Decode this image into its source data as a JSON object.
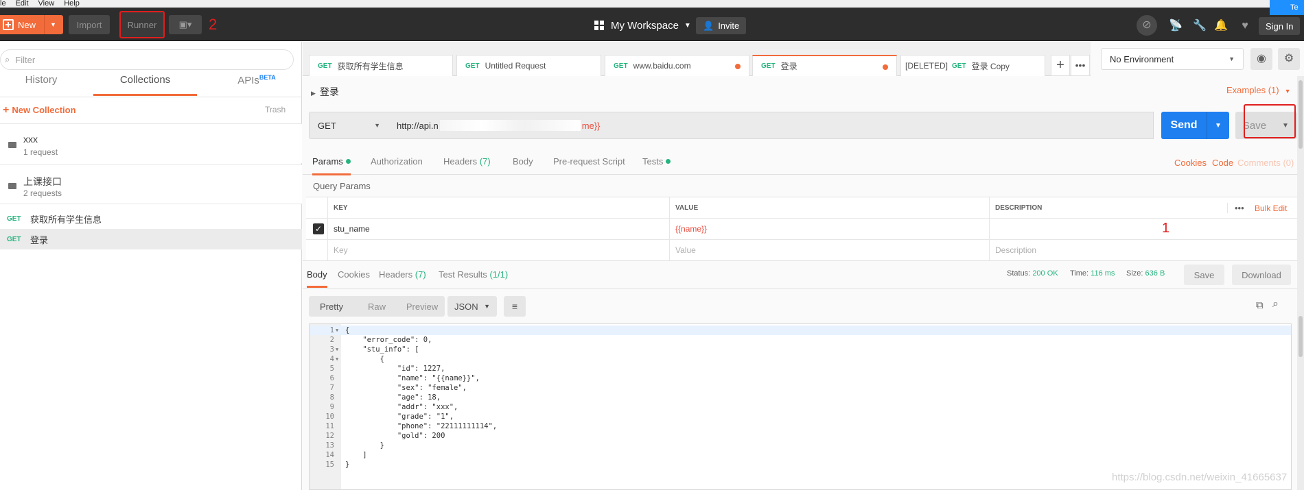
{
  "menubar": [
    "le",
    "Edit",
    "View",
    "Help"
  ],
  "header": {
    "new_label": "New",
    "import_label": "Import",
    "runner_label": "Runner",
    "annotation_2": "2",
    "workspace": "My Workspace",
    "invite": "Invite",
    "signin": "Sign In",
    "corner_badge": "Te"
  },
  "sidebar": {
    "filter_placeholder": "Filter",
    "tabs": [
      "History",
      "Collections",
      "APIs"
    ],
    "apis_badge": "BETA",
    "new_collection": "New Collection",
    "trash": "Trash",
    "folders": [
      {
        "name": "xxx",
        "count": "1 request"
      },
      {
        "name": "上课接口",
        "count": "2 requests"
      }
    ],
    "requests": [
      {
        "method": "GET",
        "name": "获取所有学生信息"
      },
      {
        "method": "GET",
        "name": "登录"
      }
    ]
  },
  "tabs": [
    {
      "method": "GET",
      "name": "获取所有学生信息",
      "prefix": ""
    },
    {
      "method": "GET",
      "name": "Untitled Request",
      "prefix": ""
    },
    {
      "method": "GET",
      "name": "www.baidu.com",
      "prefix": ""
    },
    {
      "method": "GET",
      "name": "登录",
      "prefix": ""
    },
    {
      "method": "GET",
      "name": "登录 Copy",
      "prefix": "[DELETED]"
    }
  ],
  "environment": "No Environment",
  "request": {
    "title": "登录",
    "examples": "Examples (1)",
    "method": "GET",
    "url_start": "http://api.n",
    "url_end": "me}}",
    "send": "Send",
    "save": "Save"
  },
  "subtabs": {
    "params": "Params",
    "authorization": "Authorization",
    "headers": "Headers",
    "headers_count": "(7)",
    "body": "Body",
    "prerequest": "Pre-request Script",
    "tests": "Tests",
    "cookies": "Cookies",
    "code": "Code",
    "comments": "Comments (0)"
  },
  "params": {
    "title": "Query Params",
    "headers": [
      "KEY",
      "VALUE",
      "DESCRIPTION"
    ],
    "bulk_edit": "Bulk Edit",
    "row": {
      "key": "stu_name",
      "value": "{{name}}"
    },
    "placeholders": {
      "key": "Key",
      "value": "Value",
      "description": "Description"
    },
    "annotation_1": "1"
  },
  "response": {
    "tabs": {
      "body": "Body",
      "cookies": "Cookies",
      "headers": "Headers",
      "headers_count": "(7)",
      "tests": "Test Results",
      "tests_count": "(1/1)"
    },
    "status_label": "Status:",
    "status": "200 OK",
    "time_label": "Time:",
    "time": "116 ms",
    "size_label": "Size:",
    "size": "636 B",
    "save": "Save",
    "download": "Download",
    "formats": [
      "Pretty",
      "Raw",
      "Preview"
    ],
    "format_type": "JSON"
  },
  "code_lines": [
    {
      "n": "1",
      "t": "{"
    },
    {
      "n": "2",
      "t": "    \"error_code\": 0,"
    },
    {
      "n": "3",
      "t": "    \"stu_info\": ["
    },
    {
      "n": "4",
      "t": "        {"
    },
    {
      "n": "5",
      "t": "            \"id\": 1227,"
    },
    {
      "n": "6",
      "t": "            \"name\": \"{{name}}\","
    },
    {
      "n": "7",
      "t": "            \"sex\": \"female\","
    },
    {
      "n": "8",
      "t": "            \"age\": 18,"
    },
    {
      "n": "9",
      "t": "            \"addr\": \"xxx\","
    },
    {
      "n": "10",
      "t": "            \"grade\": \"1\","
    },
    {
      "n": "11",
      "t": "            \"phone\": \"22111111114\","
    },
    {
      "n": "12",
      "t": "            \"gold\": 200"
    },
    {
      "n": "13",
      "t": "        }"
    },
    {
      "n": "14",
      "t": "    ]"
    },
    {
      "n": "15",
      "t": "}"
    }
  ],
  "watermark": "https://blog.csdn.net/weixin_41665637",
  "colors": {
    "accent": "#f26b3a",
    "send": "#1e7ff0",
    "get": "#26b47f",
    "annotation": "#e01e1e"
  }
}
